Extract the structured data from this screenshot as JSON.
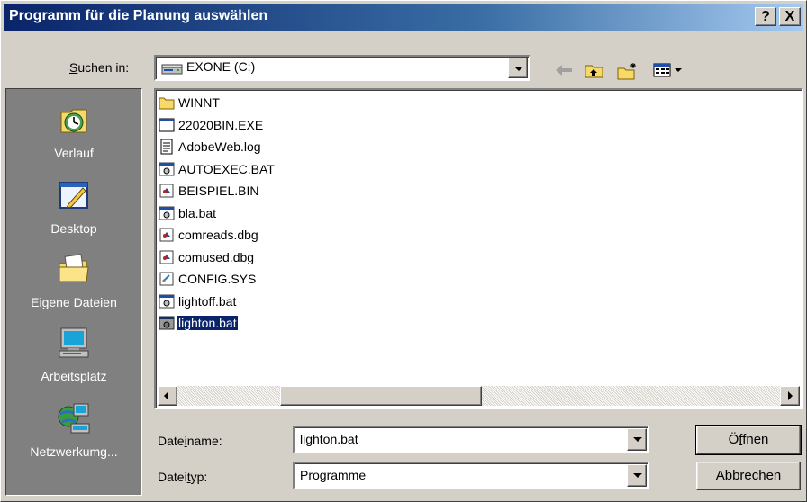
{
  "window": {
    "title": "Programm für die Planung auswählen",
    "help_label": "?",
    "close_label": "X"
  },
  "lookin": {
    "label": "Suchen in:",
    "value": "EXONE (C:)"
  },
  "places": [
    {
      "label": "Verlauf",
      "icon": "history-icon"
    },
    {
      "label": "Desktop",
      "icon": "desktop-icon"
    },
    {
      "label": "Eigene Dateien",
      "icon": "my-documents-icon"
    },
    {
      "label": "Arbeitsplatz",
      "icon": "my-computer-icon"
    },
    {
      "label": "Netzwerkumg...",
      "icon": "network-icon"
    }
  ],
  "files": [
    {
      "name": "WINNT",
      "icon": "folder-icon",
      "selected": false
    },
    {
      "name": "22020BIN.EXE",
      "icon": "exe-icon",
      "selected": false
    },
    {
      "name": "AdobeWeb.log",
      "icon": "text-file-icon",
      "selected": false
    },
    {
      "name": "AUTOEXEC.BAT",
      "icon": "batch-file-icon",
      "selected": false
    },
    {
      "name": "BEISPIEL.BIN",
      "icon": "binary-file-icon",
      "selected": false
    },
    {
      "name": "bla.bat",
      "icon": "batch-file-icon",
      "selected": false
    },
    {
      "name": "comreads.dbg",
      "icon": "binary-file-icon",
      "selected": false
    },
    {
      "name": "comused.dbg",
      "icon": "binary-file-icon",
      "selected": false
    },
    {
      "name": "CONFIG.SYS",
      "icon": "system-file-icon",
      "selected": false
    },
    {
      "name": "lightoff.bat",
      "icon": "batch-file-icon",
      "selected": false
    },
    {
      "name": "lighton.bat",
      "icon": "batch-file-icon",
      "selected": true
    }
  ],
  "filename": {
    "label": "Dateiname:",
    "value": "lighton.bat"
  },
  "filetype": {
    "label": "Dateityp:",
    "value": "Programme"
  },
  "buttons": {
    "open": "Öffnen",
    "cancel": "Abbrechen"
  },
  "colors": {
    "titlebar": "#0a246a",
    "selection": "#0a246a",
    "face": "#d4d0c8",
    "places_bg": "#808080"
  }
}
